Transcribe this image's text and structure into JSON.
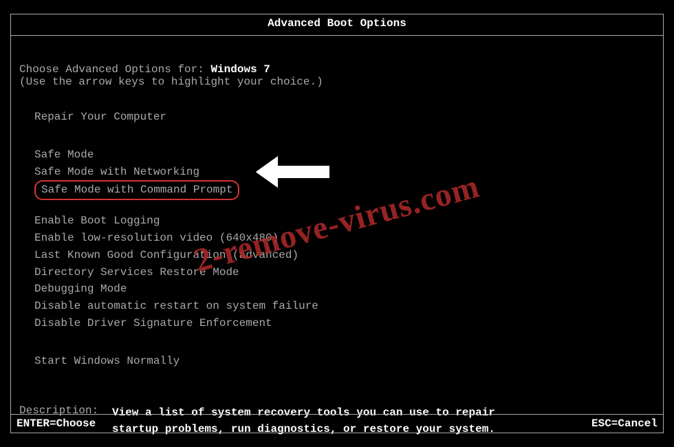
{
  "title": "Advanced Boot Options",
  "choose_prefix": "Choose Advanced Options for: ",
  "os_name": "Windows 7",
  "hint": "(Use the arrow keys to highlight your choice.)",
  "repair": "Repair Your Computer",
  "safe_modes": {
    "sm": "Safe Mode",
    "sm_net": "Safe Mode with Networking",
    "sm_cmd": "Safe Mode with Command Prompt"
  },
  "advanced": {
    "boot_log": "Enable Boot Logging",
    "low_res": "Enable low-resolution video (640x480)",
    "lkgc": "Last Known Good Configuration (advanced)",
    "dsrm": "Directory Services Restore Mode",
    "debug": "Debugging Mode",
    "no_auto_restart": "Disable automatic restart on system failure",
    "no_sig": "Disable Driver Signature Enforcement"
  },
  "start_normal": "Start Windows Normally",
  "description": {
    "label": "Description:",
    "line1": "View a list of system recovery tools you can use to repair",
    "line2": "startup problems, run diagnostics, or restore your system."
  },
  "footer": {
    "enter": "ENTER=Choose",
    "esc": "ESC=Cancel"
  },
  "watermark": "2-remove-virus.com",
  "highlight_color": "#d63333"
}
